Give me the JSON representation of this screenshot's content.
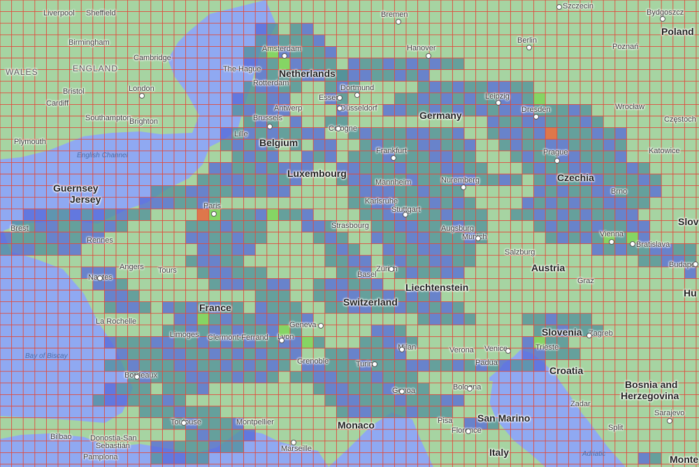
{
  "map": {
    "colors": {
      "sea": "#8fa9f2",
      "land": "#a6d4a2",
      "grid": "#e14a3c",
      "heat_low": "#5368d8",
      "heat_mid": "#4f8f9a",
      "heat_high": "#79d64f",
      "heat_peak": "#e8663c"
    },
    "labels": [
      {
        "id": "liverpool",
        "text": "Liverpool",
        "kind": "city"
      },
      {
        "id": "sheffield",
        "text": "Sheffield",
        "kind": "city"
      },
      {
        "id": "bremen",
        "text": "Bremen",
        "kind": "city"
      },
      {
        "id": "szczecin",
        "text": "Szczecin",
        "kind": "city"
      },
      {
        "id": "bydgoszcz",
        "text": "Bydgoszcz",
        "kind": "city"
      },
      {
        "id": "poland",
        "text": "Poland",
        "kind": "country"
      },
      {
        "id": "birmingham",
        "text": "Birmingham",
        "kind": "city"
      },
      {
        "id": "amsterdam",
        "text": "Amsterdam",
        "kind": "city"
      },
      {
        "id": "hanover",
        "text": "Hanover",
        "kind": "city"
      },
      {
        "id": "berlin",
        "text": "Berlin",
        "kind": "capital"
      },
      {
        "id": "poznan",
        "text": "Poznań",
        "kind": "city"
      },
      {
        "id": "cambridge",
        "text": "Cambridge",
        "kind": "city"
      },
      {
        "id": "wales",
        "text": "WALES",
        "kind": "region"
      },
      {
        "id": "england",
        "text": "ENGLAND",
        "kind": "region"
      },
      {
        "id": "thehague",
        "text": "The Hague",
        "kind": "city"
      },
      {
        "id": "netherlands",
        "text": "Netherlands",
        "kind": "country"
      },
      {
        "id": "rotterdam",
        "text": "Rotterdam",
        "kind": "city"
      },
      {
        "id": "bristol",
        "text": "Bristol",
        "kind": "city"
      },
      {
        "id": "london",
        "text": "London",
        "kind": "capital"
      },
      {
        "id": "dortmund",
        "text": "Dortmund",
        "kind": "city"
      },
      {
        "id": "leipzig",
        "text": "Leipzig",
        "kind": "city"
      },
      {
        "id": "cardiff",
        "text": "Cardiff",
        "kind": "city"
      },
      {
        "id": "essen",
        "text": "Essen",
        "kind": "city"
      },
      {
        "id": "antwerp",
        "text": "Antwerp",
        "kind": "city"
      },
      {
        "id": "dusseldorf",
        "text": "Düsseldorf",
        "kind": "city"
      },
      {
        "id": "dresden",
        "text": "Dresden",
        "kind": "city"
      },
      {
        "id": "wroclaw",
        "text": "Wrocław",
        "kind": "city"
      },
      {
        "id": "germany",
        "text": "Germany",
        "kind": "country"
      },
      {
        "id": "southampton",
        "text": "Southampton",
        "kind": "city"
      },
      {
        "id": "brighton",
        "text": "Brighton",
        "kind": "city"
      },
      {
        "id": "brussels",
        "text": "Brussels",
        "kind": "capital"
      },
      {
        "id": "czestochowa",
        "text": "Częstoch",
        "kind": "city"
      },
      {
        "id": "cologne",
        "text": "Cologne",
        "kind": "city"
      },
      {
        "id": "lille",
        "text": "Lille",
        "kind": "city"
      },
      {
        "id": "plymouth",
        "text": "Plymouth",
        "kind": "city"
      },
      {
        "id": "belgium",
        "text": "Belgium",
        "kind": "country"
      },
      {
        "id": "frankfurt",
        "text": "Frankfurt",
        "kind": "city"
      },
      {
        "id": "prague",
        "text": "Prague",
        "kind": "capital"
      },
      {
        "id": "katowice",
        "text": "Katowice",
        "kind": "city"
      },
      {
        "id": "englishchannel",
        "text": "English Channel",
        "kind": "water"
      },
      {
        "id": "luxembourg",
        "text": "Luxembourg",
        "kind": "country"
      },
      {
        "id": "czechia",
        "text": "Czechia",
        "kind": "country"
      },
      {
        "id": "mannheim",
        "text": "Mannheim",
        "kind": "city"
      },
      {
        "id": "nuremberg",
        "text": "Nuremberg",
        "kind": "city"
      },
      {
        "id": "guernsey",
        "text": "Guernsey",
        "kind": "country"
      },
      {
        "id": "jersey",
        "text": "Jersey",
        "kind": "country"
      },
      {
        "id": "brno",
        "text": "Brno",
        "kind": "city"
      },
      {
        "id": "karlsruhe",
        "text": "Karlsruhe",
        "kind": "city"
      },
      {
        "id": "paris",
        "text": "Paris",
        "kind": "capital"
      },
      {
        "id": "stuttgart",
        "text": "Stuttgart",
        "kind": "city"
      },
      {
        "id": "brest",
        "text": "Brest",
        "kind": "city"
      },
      {
        "id": "strasbourg",
        "text": "Strasbourg",
        "kind": "city"
      },
      {
        "id": "augsburg",
        "text": "Augsburg",
        "kind": "city"
      },
      {
        "id": "slovakia",
        "text": "Slov",
        "kind": "country"
      },
      {
        "id": "vienna",
        "text": "Vienna",
        "kind": "capital"
      },
      {
        "id": "rennes",
        "text": "Rennes",
        "kind": "city"
      },
      {
        "id": "munich",
        "text": "Munich",
        "kind": "city"
      },
      {
        "id": "bratislava",
        "text": "Bratislava",
        "kind": "capital"
      },
      {
        "id": "salzburg",
        "text": "Salzburg",
        "kind": "city"
      },
      {
        "id": "budapest",
        "text": "Budape",
        "kind": "capital"
      },
      {
        "id": "angers",
        "text": "Angers",
        "kind": "city"
      },
      {
        "id": "tours",
        "text": "Tours",
        "kind": "city"
      },
      {
        "id": "austria",
        "text": "Austria",
        "kind": "country"
      },
      {
        "id": "zurich",
        "text": "Zürich",
        "kind": "city"
      },
      {
        "id": "basel",
        "text": "Basel",
        "kind": "city"
      },
      {
        "id": "nantes",
        "text": "Nantes",
        "kind": "city"
      },
      {
        "id": "liechtenstein",
        "text": "Liechtenstein",
        "kind": "country"
      },
      {
        "id": "graz",
        "text": "Graz",
        "kind": "city"
      },
      {
        "id": "hungary",
        "text": "Hu",
        "kind": "country"
      },
      {
        "id": "switzerland",
        "text": "Switzerland",
        "kind": "country"
      },
      {
        "id": "france",
        "text": "France",
        "kind": "country"
      },
      {
        "id": "larochelle",
        "text": "La Rochelle",
        "kind": "city"
      },
      {
        "id": "geneva",
        "text": "Geneva",
        "kind": "city"
      },
      {
        "id": "slovenia",
        "text": "Slovenia",
        "kind": "country"
      },
      {
        "id": "zagreb",
        "text": "Zagreb",
        "kind": "capital"
      },
      {
        "id": "limoges",
        "text": "Limoges",
        "kind": "city"
      },
      {
        "id": "clermont",
        "text": "Clermont-Ferrand",
        "kind": "city"
      },
      {
        "id": "lyon",
        "text": "Lyon",
        "kind": "city"
      },
      {
        "id": "milan",
        "text": "Milan",
        "kind": "city"
      },
      {
        "id": "verona",
        "text": "Verona",
        "kind": "city"
      },
      {
        "id": "venice",
        "text": "Venice",
        "kind": "city"
      },
      {
        "id": "trieste",
        "text": "Trieste",
        "kind": "city"
      },
      {
        "id": "bayofbiscay",
        "text": "Bay of Biscay",
        "kind": "water"
      },
      {
        "id": "grenoble",
        "text": "Grenoble",
        "kind": "city"
      },
      {
        "id": "turin",
        "text": "Turin",
        "kind": "city"
      },
      {
        "id": "padua",
        "text": "Padua",
        "kind": "city"
      },
      {
        "id": "croatia",
        "text": "Croatia",
        "kind": "country"
      },
      {
        "id": "bordeaux",
        "text": "Bordeaux",
        "kind": "city"
      },
      {
        "id": "bosnia",
        "text": "Bosnia and",
        "kind": "country"
      },
      {
        "id": "herzegovina",
        "text": "Herzegovina",
        "kind": "country"
      },
      {
        "id": "genoa",
        "text": "Genoa",
        "kind": "city"
      },
      {
        "id": "bologna",
        "text": "Bologna",
        "kind": "city"
      },
      {
        "id": "zadar",
        "text": "Zadar",
        "kind": "city"
      },
      {
        "id": "toulouse",
        "text": "Toulouse",
        "kind": "city"
      },
      {
        "id": "montpellier",
        "text": "Montpellier",
        "kind": "city"
      },
      {
        "id": "monaco",
        "text": "Monaco",
        "kind": "country"
      },
      {
        "id": "pisa",
        "text": "Pisa",
        "kind": "city"
      },
      {
        "id": "sanmarino",
        "text": "San Marino",
        "kind": "country"
      },
      {
        "id": "sarajevo",
        "text": "Sarajevo",
        "kind": "capital"
      },
      {
        "id": "bilbao",
        "text": "Bilbao",
        "kind": "city"
      },
      {
        "id": "donostia",
        "text": "Donostia-San",
        "kind": "city"
      },
      {
        "id": "sebastian",
        "text": "Sebastián",
        "kind": "city"
      },
      {
        "id": "florence",
        "text": "Florence",
        "kind": "city"
      },
      {
        "id": "split",
        "text": "Split",
        "kind": "city"
      },
      {
        "id": "marseille",
        "text": "Marseille",
        "kind": "city"
      },
      {
        "id": "pamplona",
        "text": "Pamplona",
        "kind": "city"
      },
      {
        "id": "italy",
        "text": "Italy",
        "kind": "country"
      },
      {
        "id": "adriatic",
        "text": "Adriatic",
        "kind": "water"
      },
      {
        "id": "montenegro",
        "text": "Monte",
        "kind": "country"
      }
    ]
  }
}
